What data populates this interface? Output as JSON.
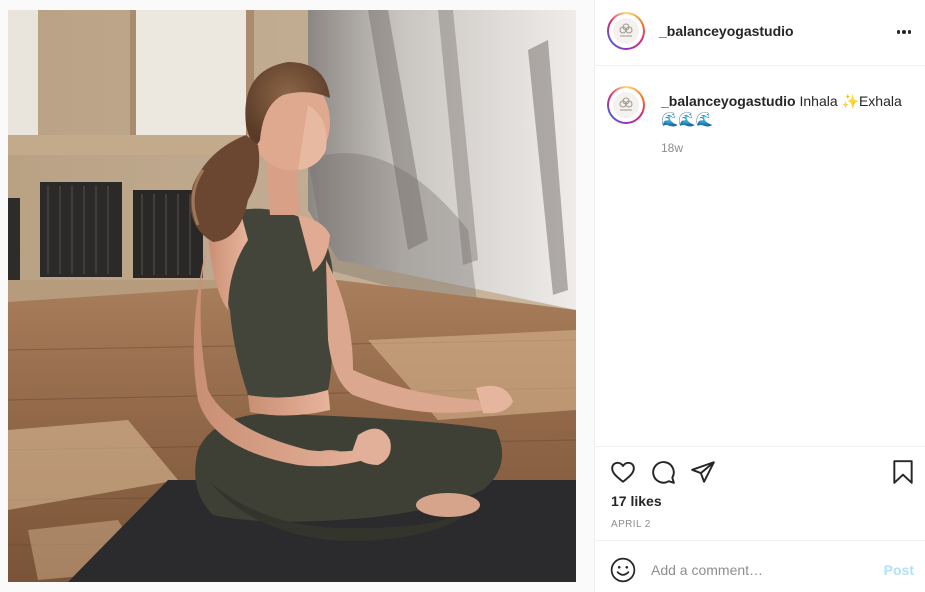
{
  "post": {
    "username": "_balanceyogastudio",
    "caption": "Inhala ✨Exhala 🌊🌊🌊",
    "time_ago": "18w",
    "likes": "17 likes",
    "date": "APRIL 2"
  },
  "comment_box": {
    "placeholder": "Add a comment…",
    "post_label": "Post"
  },
  "icons": {
    "more": "more-options-icon",
    "like": "heart-icon",
    "comment": "comment-bubble-icon",
    "share": "paper-plane-icon",
    "save": "bookmark-icon",
    "emoji": "emoji-smiley-icon"
  },
  "colors": {
    "post_button_disabled": "#b2dffc",
    "muted_text": "#8e8e8e",
    "text": "#262626"
  }
}
